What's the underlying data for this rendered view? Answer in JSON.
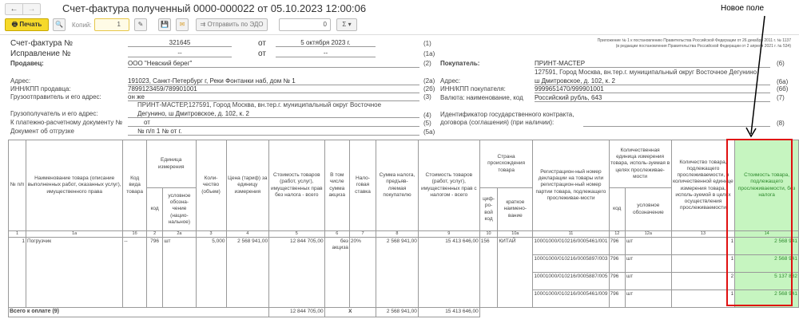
{
  "window": {
    "title": "Счет-фактура полученный 0000-000022 от 05.10.2023 12:00:06"
  },
  "toolbar": {
    "print_label": "Печать",
    "copies_label": "Копий:",
    "copies_value": "1",
    "send_edo_label": "Отправить по ЭДО",
    "sum_value": "0",
    "sigma_label": "Σ"
  },
  "annotation": {
    "label": "Новое поле"
  },
  "header": {
    "invoice_label": "Счет-фактура №",
    "invoice_number": "321645",
    "ot1": "от",
    "invoice_date": "5 октября 2023 г.",
    "n1": "(1)",
    "correction_label": "Исправление №",
    "correction_number": "--",
    "ot2": "от",
    "correction_date": "--",
    "n1a": "(1а)",
    "appendix_line1": "Приложение № 1 к постановлению Правительства Российской Федерации от 26 декабря 2011 г. № 1137",
    "appendix_line2": "(в редакции постановления Правительства Российской Федерации от 2 апреля 2021 г. № 534)",
    "seller_label": "Продавец:",
    "seller": "ООО \"Невский берег\"",
    "n2": "(2)",
    "address_label": "Адрес:",
    "address": "191023, Санкт-Петербург г, Реки Фонтанки наб, дом № 1",
    "n2a": "(2а)",
    "inn_label": "ИНН/КПП продавца:",
    "inn": "7899123459/789901001",
    "n2b": "(2б)",
    "shipper_label": "Грузоотправитель и его адрес:",
    "shipper": "он же",
    "n3": "(3)",
    "consignee_label": "Грузополучатель и его адрес:",
    "consignee_line1": "ПРИНТ-МАСТЕР,127591, Город Москва, вн.тер.г. муниципальный округ Восточное",
    "consignee_line2": "Дегунино, ш Дмитровское, д. 102, к. 2",
    "n4": "(4)",
    "payment_label": "К платежно-расчетному документу №",
    "payment": "от",
    "n5": "(5)",
    "shipment_label": "Документ об отгрузке",
    "shipment": "№ п/п 1 №  от  г.",
    "n5a": "(5а)",
    "buyer_label": "Покупатель:",
    "buyer": "ПРИНТ-МАСТЕР",
    "n6": "(6)",
    "buyer_address_label": "Адрес:",
    "buyer_address_line1": "127591, Город Москва, вн.тер.г. муниципальный округ Восточное Дегунино,",
    "buyer_address_line2": "ш Дмитровское, д. 102, к. 2",
    "n6a": "(6а)",
    "buyer_inn_label": "ИНН/КПП покупателя:",
    "buyer_inn": "9999651470/999901001",
    "n6b": "(6б)",
    "currency_label": "Валюта: наименование, код",
    "currency": "Российский рубль, 643",
    "n7": "(7)",
    "contract_label1": "Идентификатор государственного контракта,",
    "contract_label2": "договора (соглашения) (при наличии):",
    "n8": "(8)"
  },
  "table": {
    "h": {
      "c1": "№ п/п",
      "c1a": "Наименование товара (описание выполненных работ, оказанных услуг), имущественного права",
      "c1b": "Код вида товара",
      "unit": "Единица измерения",
      "c2": "код",
      "c2a": "условное обозна-чение (нацио-нальное)",
      "c3": "Коли-чество (объем)",
      "c4": "Цена (тариф) за единицу измерения",
      "c5": "Стоимость товаров (работ, услуг), имущественных прав без налога - всего",
      "c6": "В том числе сумма акциза",
      "c7": "Нало-говая ставка",
      "c8": "Сумма налога, предъяв-ляемая покупателю",
      "c9": "Стоимость товаров (работ, услуг), имущественных прав с налогом - всего",
      "country": "Страна происхождения товара",
      "c10": "циф-ро-вой код",
      "c10a": "краткое наимено-вание",
      "c11": "Регистрацион-ный номер декларации на товары или регистрацион-ный номер партии товара, подлежащего прослеживае-мости",
      "qunit": "Количественная единица измерения товара, исполь-зуемая в целях прослеживае-мости",
      "c12": "код",
      "c12a": "условное обозначение",
      "c13": "Количество товара, подлежащего прослеживаемости, в количественной единице измерения товара, исполь-зуемой в целях осуществления прослеживаемости",
      "c14": "Стоимость товара, подлежащего прослеживаемости, без налога"
    },
    "nums": [
      "1",
      "1а",
      "1б",
      "2",
      "2а",
      "3",
      "4",
      "5",
      "6",
      "7",
      "8",
      "9",
      "10",
      "10а",
      "11",
      "12",
      "12а",
      "13",
      "14"
    ],
    "row": {
      "n": "1",
      "name": "Погрузчик",
      "kind": "--",
      "unit_code": "796",
      "unit": "шт",
      "qty": "5,000",
      "price": "2 568 941,00",
      "cost": "12 844 705,00",
      "excise": "без акциза",
      "rate": "20%",
      "tax": "2 568 941,00",
      "total": "15 413 646,00",
      "country_code": "156",
      "country": "КИТАЙ"
    },
    "trace": [
      {
        "reg": "10001000/010216/0005461/001",
        "code": "796",
        "unit": "шт",
        "qty": "1",
        "cost": "2 568 941"
      },
      {
        "reg": "10001000/010216/0005897/003",
        "code": "796",
        "unit": "шт",
        "qty": "1",
        "cost": "2 568 941"
      },
      {
        "reg": "10001000/010216/0005887/005",
        "code": "796",
        "unit": "шт",
        "qty": "2",
        "cost": "5 137 882"
      },
      {
        "reg": "10001000/010216/0005461/009",
        "code": "796",
        "unit": "шт",
        "qty": "1",
        "cost": "2 568 941"
      }
    ],
    "totals": {
      "label": "Всего к оплате (9)",
      "cost": "12 844 705,00",
      "x": "X",
      "tax": "2 568 941,00",
      "total": "15 413 646,00"
    }
  }
}
